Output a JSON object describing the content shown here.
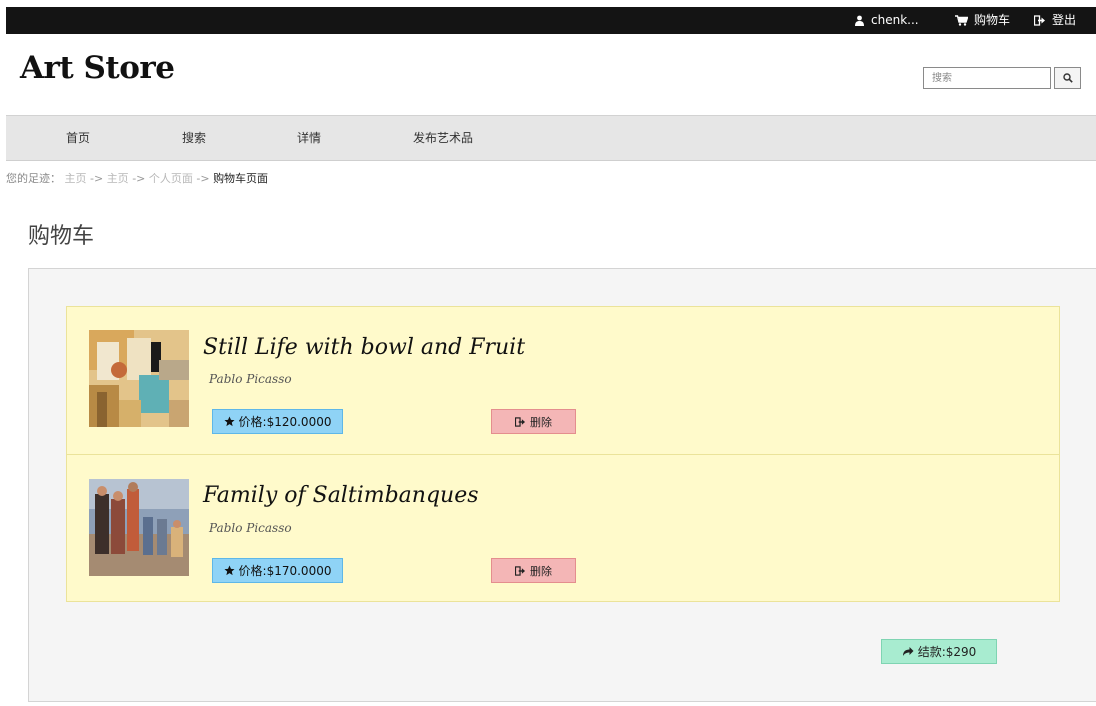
{
  "topbar": {
    "user_name": "chenk...",
    "user_icon": "user-icon",
    "cart_label": "购物车",
    "cart_icon": "cart-icon",
    "logout_label": "登出",
    "logout_icon": "logout-icon"
  },
  "header": {
    "logo": "Art Store",
    "search_placeholder": "搜索",
    "search_icon": "search-icon"
  },
  "nav": {
    "items": [
      {
        "label": "首页"
      },
      {
        "label": "搜索"
      },
      {
        "label": "详情"
      },
      {
        "label": "发布艺术品"
      }
    ]
  },
  "breadcrumb": {
    "prefix": "您的足迹：",
    "links": [
      "主页",
      "主页",
      "个人页面"
    ],
    "separator": "->",
    "current": "购物车页面"
  },
  "page": {
    "title": "购物车"
  },
  "cart": {
    "items": [
      {
        "title": "Still Life with bowl and Fruit",
        "artist": "Pablo Picasso",
        "price_label": "价格:$120.0000",
        "delete_label": "删除"
      },
      {
        "title": "Family of Saltimbanques",
        "artist": "Pablo Picasso",
        "price_label": "价格:$170.0000",
        "delete_label": "删除"
      }
    ],
    "checkout_label": "结款:$290"
  },
  "colors": {
    "topbar": "#141414",
    "nav": "#e6e6e6",
    "cart_bg": "#fffacb",
    "price_button": "#8fd3f6",
    "delete_button": "#f4b6b6",
    "checkout_button": "#a8ecd0"
  }
}
